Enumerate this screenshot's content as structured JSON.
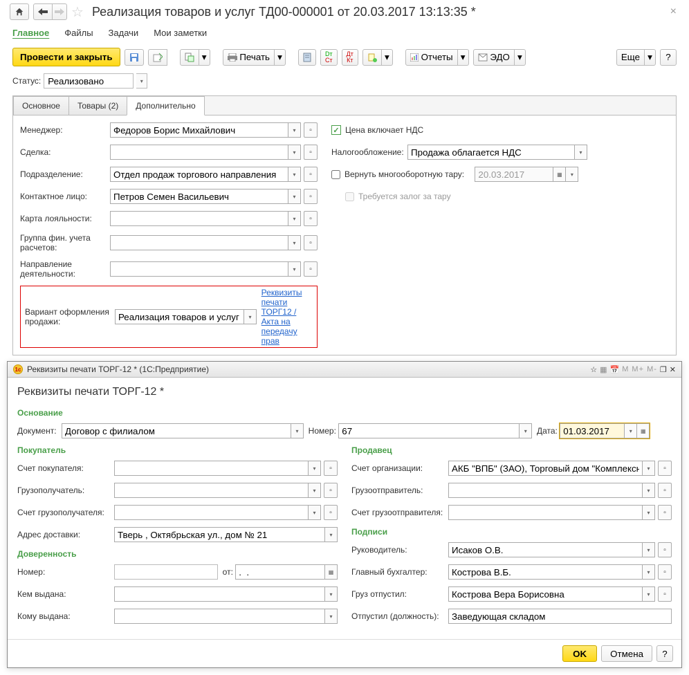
{
  "header": {
    "title": "Реализация товаров и услуг ТД00-000001 от 20.03.2017 13:13:35 *"
  },
  "nav": {
    "main": "Главное",
    "files": "Файлы",
    "tasks": "Задачи",
    "notes": "Мои заметки"
  },
  "toolbar": {
    "post_close": "Провести и закрыть",
    "print": "Печать",
    "reports": "Отчеты",
    "edo": "ЭДО",
    "more": "Еще",
    "help": "?"
  },
  "status": {
    "label": "Статус:",
    "value": "Реализовано"
  },
  "subtabs": {
    "main": "Основное",
    "goods": "Товары (2)",
    "extra": "Дополнительно"
  },
  "form": {
    "manager_label": "Менеджер:",
    "manager": "Федоров Борис Михайлович",
    "deal_label": "Сделка:",
    "dept_label": "Подразделение:",
    "dept": "Отдел продаж торгового направления",
    "contact_label": "Контактное лицо:",
    "contact": "Петров Семен Васильевич",
    "loyalty_label": "Карта лояльности:",
    "fingroup_label": "Группа фин. учета расчетов:",
    "direction_label": "Направление деятельности:",
    "variant_label": "Вариант оформления продажи:",
    "variant": "Реализация товаров и услуг",
    "print_link": "Реквизиты печати ТОРГ12 / Акта на передачу прав",
    "price_vat": "Цена включает НДС",
    "tax_label": "Налогообложение:",
    "tax": "Продажа облагается НДС",
    "return_tare": "Вернуть многооборотную тару:",
    "return_date": "20.03.2017",
    "tare_deposit": "Требуется залог за тару"
  },
  "dialog": {
    "wintitle": "Реквизиты печати ТОРГ-12 *  (1С:Предприятие)",
    "mtext": "М  М+  М-",
    "title": "Реквизиты печати ТОРГ-12 *",
    "basis": "Основание",
    "doc_label": "Документ:",
    "doc": "Договор с филиалом",
    "num_label": "Номер:",
    "num": "67",
    "date_label": "Дата:",
    "date": "01.03.2017",
    "buyer": "Покупатель",
    "buyer_account": "Счет покупателя:",
    "consignee": "Грузополучатель:",
    "consignee_account": "Счет грузополучателя:",
    "delivery": "Адрес доставки:",
    "delivery_val": "Тверь , Октябрьская ул., дом № 21",
    "proxy": "Доверенность",
    "proxy_num": "Номер:",
    "proxy_from": "от:",
    "proxy_date": ".  .",
    "issued_by": "Кем выдана:",
    "issued_to": "Кому выдана:",
    "seller": "Продавец",
    "org_account": "Счет организации:",
    "org_account_val": "АКБ \"ВПБ\" (ЗАО), Торговый дом \"Комплексны",
    "consignor": "Грузоотправитель:",
    "consignor_account": "Счет грузоотправителя:",
    "sigs": "Подписи",
    "head": "Руководитель:",
    "head_val": "Исаков О.В.",
    "accountant": "Главный бухгалтер:",
    "accountant_val": "Кострова В.Б.",
    "released": "Груз отпустил:",
    "released_val": "Кострова Вера Борисовна",
    "released_pos": "Отпустил (должность):",
    "released_pos_val": "Заведующая складом",
    "ok": "OK",
    "cancel": "Отмена",
    "help": "?"
  }
}
